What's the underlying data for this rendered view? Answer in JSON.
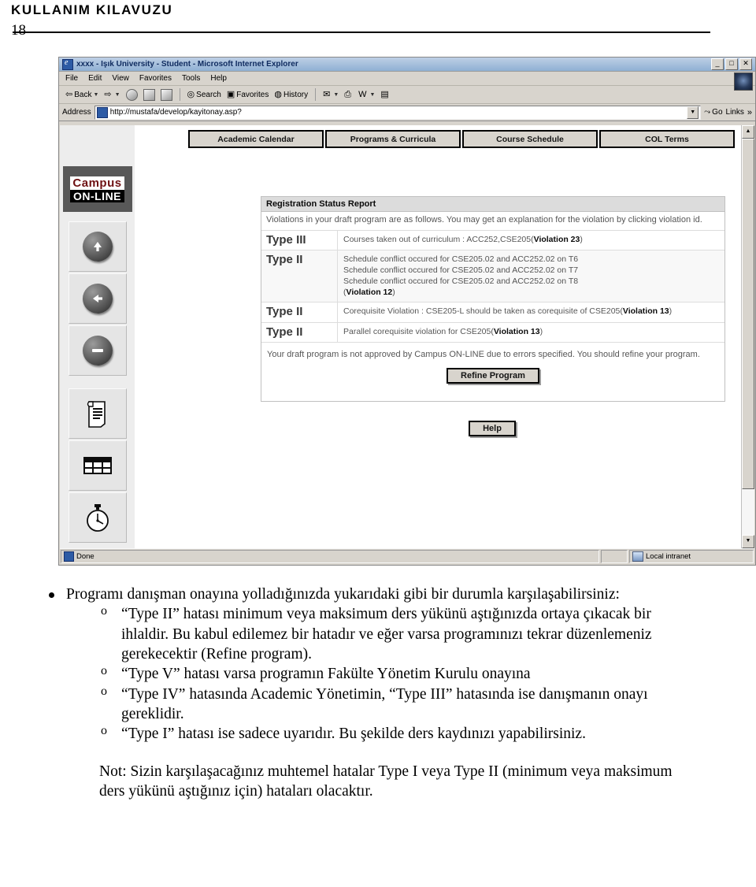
{
  "document": {
    "header_title": "KULLANIM KILAVUZU",
    "page_number": "18"
  },
  "browser": {
    "window_title": "xxxx - Işık University - Student - Microsoft Internet Explorer",
    "window_controls": {
      "minimize": "_",
      "restore": "□",
      "close": "✕"
    },
    "menu": [
      "File",
      "Edit",
      "View",
      "Favorites",
      "Tools",
      "Help"
    ],
    "toolbar": {
      "back": "Back",
      "forward": "",
      "stop": "",
      "refresh": "",
      "home": "",
      "search": "Search",
      "favorites": "Favorites",
      "history": "History",
      "mail": "",
      "print": "",
      "edit": "W",
      "discuss": ""
    },
    "address": {
      "label": "Address",
      "url": "http://mustafa/develop/kayitonay.asp?",
      "go": "Go",
      "links": "Links",
      "chevrons": "»"
    },
    "statusbar": {
      "status": "Done",
      "zone": "Local intranet"
    }
  },
  "page": {
    "logo": {
      "line1": "Campus",
      "line2": "ON-LINE"
    },
    "sidebar_buttons": [
      {
        "name": "up-arrow-button",
        "icon": "arrow-up-icon"
      },
      {
        "name": "back-arrow-button",
        "icon": "arrow-left-icon"
      },
      {
        "name": "stop-button",
        "icon": "minus-icon"
      },
      {
        "name": "document-button",
        "icon": "scroll-document-icon"
      },
      {
        "name": "table-button",
        "icon": "grid-table-icon"
      },
      {
        "name": "clock-button",
        "icon": "stopwatch-icon"
      }
    ],
    "tabs": [
      "Academic Calendar",
      "Programs & Curricula",
      "Course Schedule",
      "COL Terms"
    ],
    "report": {
      "title": "Registration Status Report",
      "intro": "Violations in your draft program are as follows. You may get an explanation for the violation by clicking violation id.",
      "rows": [
        {
          "type": "Type III",
          "lines": [
            "Courses taken out of curriculum : ACC252,CSE205(Violation 23)"
          ],
          "violation": "Violation 23"
        },
        {
          "type": "Type II",
          "lines": [
            "Schedule conflict occured for CSE205.02 and ACC252.02 on T6",
            "Schedule conflict occured for CSE205.02 and ACC252.02 on T7",
            "Schedule conflict occured for CSE205.02 and ACC252.02 on T8",
            "(Violation 12)"
          ],
          "violation": "Violation 12"
        },
        {
          "type": "Type II",
          "lines": [
            "Corequisite Violation : CSE205-L should be taken as corequisite of CSE205(Violation 13)"
          ],
          "violation": "Violation 13"
        },
        {
          "type": "Type II",
          "lines": [
            "Parallel corequisite violation for CSE205(Violation 13)"
          ],
          "violation": "Violation 13"
        }
      ],
      "notice": "Your draft program is not approved by Campus ON-LINE due to errors specified. You should refine your program.",
      "refine_button": "Refine Program"
    },
    "help_button": "Help"
  },
  "body": {
    "bullet1": "Programı danışman onayına yolladığınızda yukarıdaki gibi bir durumla karşılaşabilirsiniz:",
    "sub1": "“Type II” hatası minimum veya maksimum ders yükünü aştığınızda ortaya çıkacak bir ihlaldir. Bu kabul edilemez bir hatadır ve eğer varsa programınızı tekrar düzenlemeniz gerekecektir (Refine program).",
    "sub2": "“Type V” hatası varsa programın Fakülte Yönetim Kurulu onayına",
    "sub3": "“Type IV” hatasında Academic Yönetimin, “Type III” hatasında ise danışmanın onayı gereklidir.",
    "sub4": "“Type I” hatası ise sadece uyarıdır. Bu şekilde ders kaydınızı yapabilirsiniz.",
    "note": "Not: Sizin karşılaşacağınız muhtemel hatalar Type I veya Type II (minimum veya maksimum ders yükünü aştığınız için) hataları olacaktır."
  },
  "colors": {
    "logo_red": "#7a1214",
    "titlebar_blue": "#8aaed6",
    "chrome_gray": "#d4d0c8"
  }
}
